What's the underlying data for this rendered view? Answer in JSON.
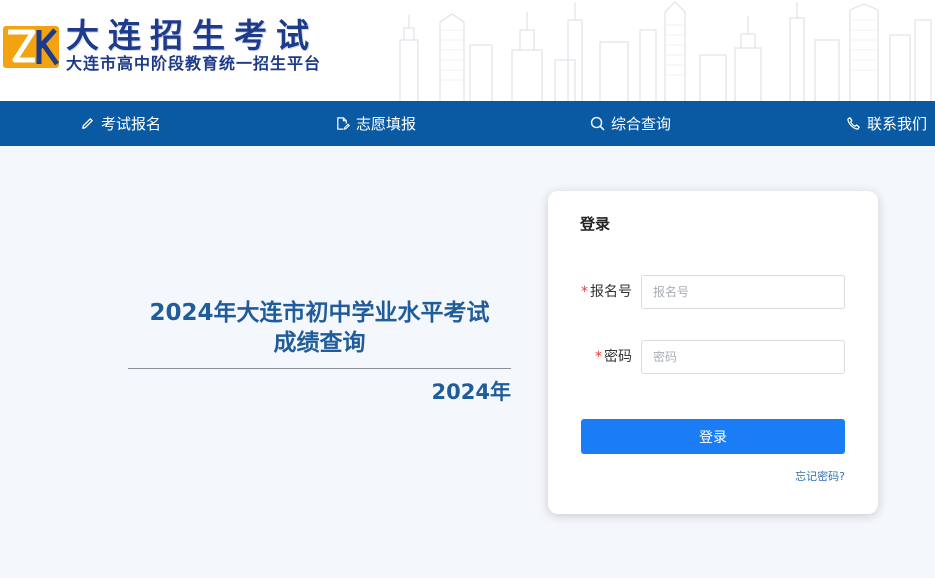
{
  "header": {
    "title": "大连招生考试",
    "subtitle": "大连市高中阶段教育统一招生平台",
    "logo_text": "ZK"
  },
  "nav": {
    "items": [
      {
        "label": "考试报名",
        "icon": "pencil-icon"
      },
      {
        "label": "志愿填报",
        "icon": "file-edit-icon"
      },
      {
        "label": "综合查询",
        "icon": "search-icon"
      },
      {
        "label": "联系我们",
        "icon": "phone-icon"
      }
    ]
  },
  "main": {
    "headline_line1": "2024年大连市初中学业水平考试",
    "headline_line2": "成绩查询",
    "year": "2024年"
  },
  "login": {
    "title": "登录",
    "required_mark": "*",
    "fields": [
      {
        "label": "报名号",
        "placeholder": "报名号",
        "value": ""
      },
      {
        "label": "密码",
        "placeholder": "密码",
        "value": ""
      }
    ],
    "submit_label": "登录",
    "forgot_label": "忘记密码?"
  },
  "colors": {
    "nav_bg": "#0a5aa3",
    "accent_button": "#1a7df5",
    "headline": "#1f5c99",
    "logo_orange": "#f2a30f",
    "logo_blue": "#1e3a8a",
    "required": "#e63b3b"
  }
}
